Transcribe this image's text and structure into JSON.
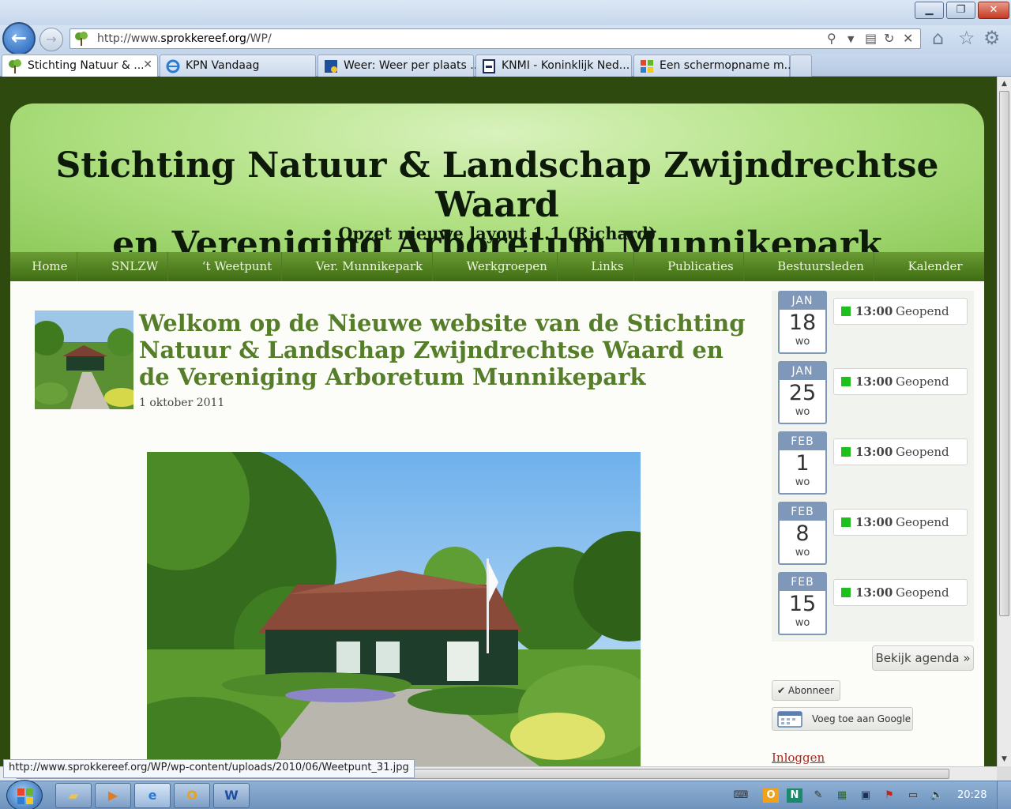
{
  "browser": {
    "address_url_prefix": "http://www.",
    "address_url_host": "sprokkereef.org",
    "address_url_suffix": "/WP/",
    "tabs": [
      {
        "label": "Stichting Natuur & ..."
      },
      {
        "label": "KPN Vandaag"
      },
      {
        "label": "Weer: Weer per plaats ..."
      },
      {
        "label": "KNMI - Koninklijk Ned..."
      },
      {
        "label": "Een schermopname m..."
      }
    ],
    "status_url": "http://www.sprokkereef.org/WP/wp-content/uploads/2010/06/Weetpunt_31.jpg"
  },
  "site": {
    "title_line1": "Stichting Natuur & Landschap Zwijndrechtse Waard",
    "title_line2": "en Vereniging Arboretum Munnikepark",
    "subtitle": "Opzet nieuwe layout 1.1 (Richard)",
    "nav": [
      "Home",
      "SNLZW",
      "‘t Weetpunt",
      "Ver. Munnikepark",
      "Werkgroepen",
      "Links",
      "Publicaties",
      "Bestuursleden",
      "Kalender"
    ]
  },
  "post": {
    "title": "Welkom op de Nieuwe website van de Stichting Natuur & Landschap Zwijndrechtse Waard en de Vereniging Arboretum Munnikepark",
    "date": "1 oktober 2011"
  },
  "agenda": {
    "events": [
      {
        "month": "JAN",
        "day": "18",
        "weekday": "wo",
        "time": "13:00",
        "title": "Geopend"
      },
      {
        "month": "JAN",
        "day": "25",
        "weekday": "wo",
        "time": "13:00",
        "title": "Geopend"
      },
      {
        "month": "FEB",
        "day": "1",
        "weekday": "wo",
        "time": "13:00",
        "title": "Geopend"
      },
      {
        "month": "FEB",
        "day": "8",
        "weekday": "wo",
        "time": "13:00",
        "title": "Geopend"
      },
      {
        "month": "FEB",
        "day": "15",
        "weekday": "wo",
        "time": "13:00",
        "title": "Geopend"
      }
    ],
    "more_link": "Bekijk agenda »",
    "subscribe_label": "✔ Abonneer",
    "google_label": "Voeg toe aan Google",
    "login_label": "Inloggen"
  },
  "taskbar": {
    "clock": "20:28"
  },
  "colors": {
    "nav_green": "#4f7d1f",
    "title_green": "#567d2a",
    "page_dark": "#2e4a0f",
    "event_dot": "#1ec01e",
    "login_red": "#b0241c"
  }
}
